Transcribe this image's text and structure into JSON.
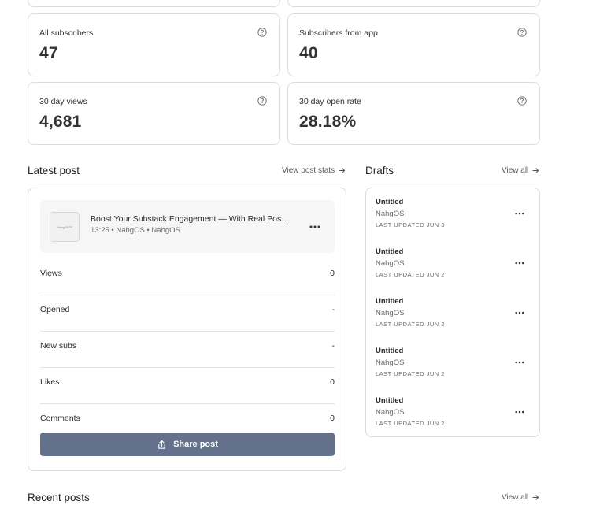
{
  "stats": [
    {
      "label": "All subscribers",
      "value": "47"
    },
    {
      "label": "Subscribers from app",
      "value": "40"
    },
    {
      "label": "30 day views",
      "value": "4,681"
    },
    {
      "label": "30 day open rate",
      "value": "28.18%"
    }
  ],
  "latest_post": {
    "heading": "Latest post",
    "view_stats_link": "View post stats",
    "thumbnail_text": "NahgOS™",
    "title": "Boost Your Substack Engagement — With Real Post-Le...",
    "meta": "13:25 • NahgOS • NahgOS",
    "metrics": [
      {
        "label": "Views",
        "value": "0"
      },
      {
        "label": "Opened",
        "value": "-"
      },
      {
        "label": "New subs",
        "value": "-"
      },
      {
        "label": "Likes",
        "value": "0"
      },
      {
        "label": "Comments",
        "value": "0"
      }
    ],
    "share_label": "Share post"
  },
  "drafts": {
    "heading": "Drafts",
    "view_all_link": "View all",
    "items": [
      {
        "title": "Untitled",
        "author": "NahgOS",
        "updated": "LAST UPDATED JUN 3"
      },
      {
        "title": "Untitled",
        "author": "NahgOS",
        "updated": "LAST UPDATED JUN 2"
      },
      {
        "title": "Untitled",
        "author": "NahgOS",
        "updated": "LAST UPDATED JUN 2"
      },
      {
        "title": "Untitled",
        "author": "NahgOS",
        "updated": "LAST UPDATED JUN 2"
      },
      {
        "title": "Untitled",
        "author": "NahgOS",
        "updated": "LAST UPDATED JUN 2"
      }
    ]
  },
  "recent_posts": {
    "heading": "Recent posts",
    "view_all_link": "View all"
  },
  "colors": {
    "share_button": "#63728a",
    "card_border": "#dcdcdc",
    "post_row_bg": "#f6f6f6"
  },
  "icons": [
    "help-circle-icon",
    "arrow-right-icon",
    "more-horizontal-icon",
    "share-upload-icon"
  ]
}
